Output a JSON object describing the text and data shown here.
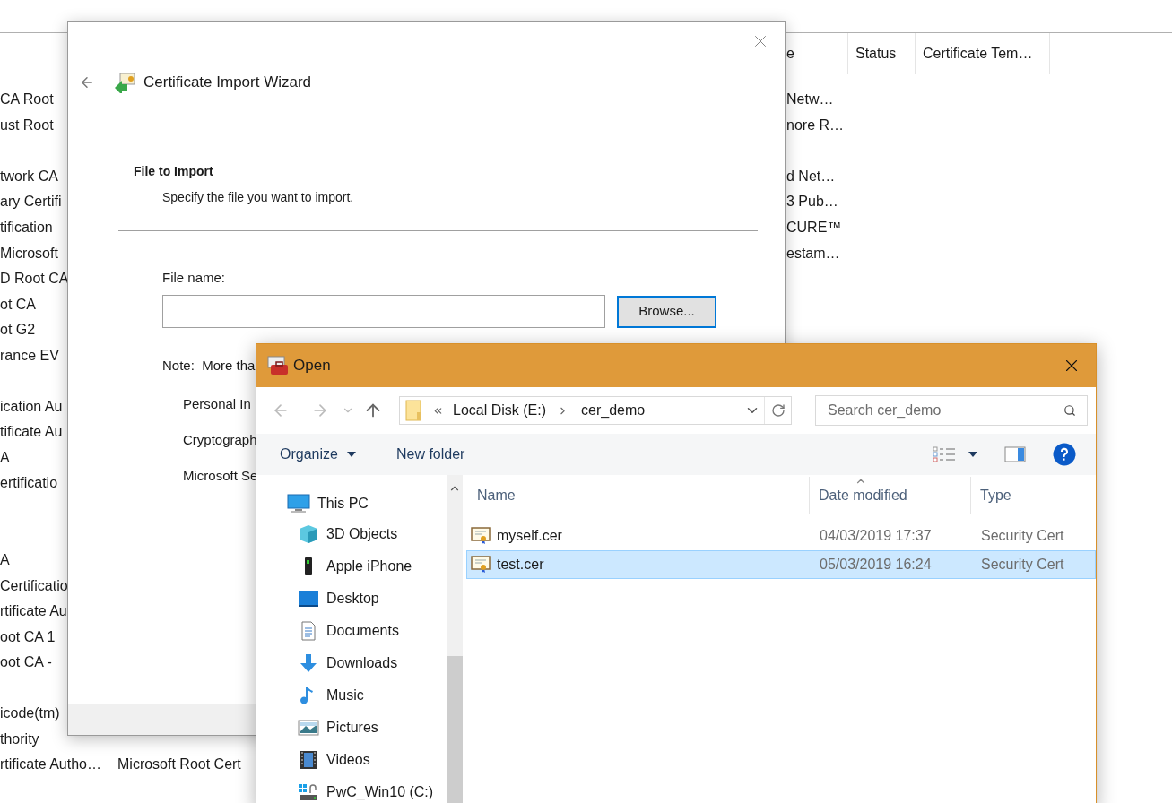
{
  "background_list": {
    "columns": [
      {
        "label": "e"
      },
      {
        "label": "Status"
      },
      {
        "label": "Certificate Tem…"
      }
    ],
    "rows": [
      {
        "column_1": "CA Root",
        "column_3": "Netw…"
      },
      {
        "column_1": "ust Root",
        "column_3": "nore R…"
      },
      {},
      {
        "column_1": "twork CA",
        "column_3": "d Net…"
      },
      {
        "column_1": "ary Certifi",
        "column_3": "3 Pub…"
      },
      {
        "column_1": "tification",
        "column_3": "CURE™"
      },
      {
        "column_1": "Microsoft",
        "column_3": "estam…"
      },
      {
        "column_1": "D Root CA"
      },
      {
        "column_1": "ot CA"
      },
      {
        "column_1": "ot G2"
      },
      {
        "column_1": "rance EV"
      },
      {},
      {
        "column_1": "ication Au"
      },
      {
        "column_1": "tificate Au"
      },
      {
        "column_1": "A"
      },
      {
        "column_1": "ertificatio"
      },
      {},
      {},
      {
        "column_1": "A"
      },
      {
        "column_1": "Certificatio"
      },
      {
        "column_1": "rtificate Au"
      },
      {
        "column_1": "oot CA 1"
      },
      {
        "column_1": "oot CA -"
      },
      {},
      {
        "column_1": "icode(tm)"
      },
      {
        "column_1": "thority"
      },
      {
        "column_1": "rtificate Autho…",
        "column_2": "Microsoft Root Cert"
      }
    ]
  },
  "wizard": {
    "title": "Certificate Import Wizard",
    "heading": "File to Import",
    "subheading": "Specify the file you want to import.",
    "file_name_label": "File name:",
    "browse_button": "Browse...",
    "note": "Note:  More tha",
    "note_items": [
      "Personal In",
      "Cryptograph",
      "Microsoft Se"
    ]
  },
  "open_dialog": {
    "title": "Open",
    "breadcrumb": [
      "Local Disk (E:)",
      "cer_demo"
    ],
    "search": {
      "placeholder": "Search cer_demo"
    },
    "toolbar": [
      "Organize",
      "New folder"
    ],
    "navigation": [
      {
        "label": "This PC",
        "children": [
          {
            "label": "3D Objects"
          },
          {
            "label": "Apple iPhone"
          },
          {
            "label": "Desktop"
          },
          {
            "label": "Documents"
          },
          {
            "label": "Downloads"
          },
          {
            "label": "Music"
          },
          {
            "label": "Pictures"
          },
          {
            "label": "Videos"
          },
          {
            "label": "PwC_Win10 (C:)"
          }
        ]
      }
    ],
    "columns": [
      "Name",
      "Date modified",
      "Type"
    ],
    "files": [
      {
        "name": "myself.cer",
        "date_modified": "04/03/2019 17:37",
        "type": "Security Cert",
        "selected": false
      },
      {
        "name": "test.cer",
        "date_modified": "05/03/2019 16:24",
        "type": "Security Cert",
        "selected": true
      }
    ]
  }
}
